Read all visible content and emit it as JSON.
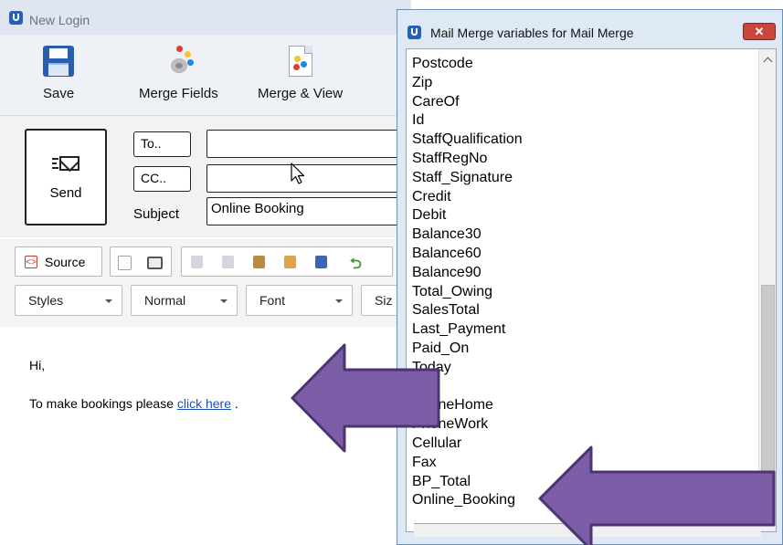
{
  "main_window": {
    "title": "New Login",
    "toolbar": {
      "save_label": "Save",
      "merge_fields_label": "Merge Fields",
      "merge_view_label": "Merge & View"
    },
    "header": {
      "send_label": "Send",
      "to_label": "To..",
      "cc_label": "CC..",
      "to_value": "",
      "cc_value": "",
      "subject_label": "Subject",
      "subject_value": "Online Booking"
    },
    "editor_toolbar": {
      "source_label": "Source",
      "styles_label": "Styles",
      "format_label": "Normal",
      "font_label": "Font",
      "size_label": "Siz"
    },
    "body": {
      "greeting": "Hi,",
      "line_prefix": "To make bookings please ",
      "link_text": "click here",
      "line_suffix": " ."
    }
  },
  "dialog": {
    "title": "Mail Merge variables for Mail Merge",
    "close_label": "✕",
    "variables": [
      "Postcode",
      "Zip",
      "CareOf",
      "Id",
      "StaffQualification",
      "StaffRegNo",
      "Staff_Signature",
      "Credit",
      "Debit",
      "Balance30",
      "Balance60",
      "Balance90",
      "Total_Owing",
      "SalesTotal",
      "Last_Payment",
      "Paid_On",
      "Today",
      "",
      "PhoneHome",
      "PhoneWork",
      "Cellular",
      "Fax",
      "BP_Total",
      "Online_Booking"
    ]
  },
  "colors": {
    "arrow_fill": "#7b5ea7",
    "arrow_stroke": "#4b3470",
    "link": "#1f4fbf",
    "title_icon": "#2b5fb5"
  }
}
